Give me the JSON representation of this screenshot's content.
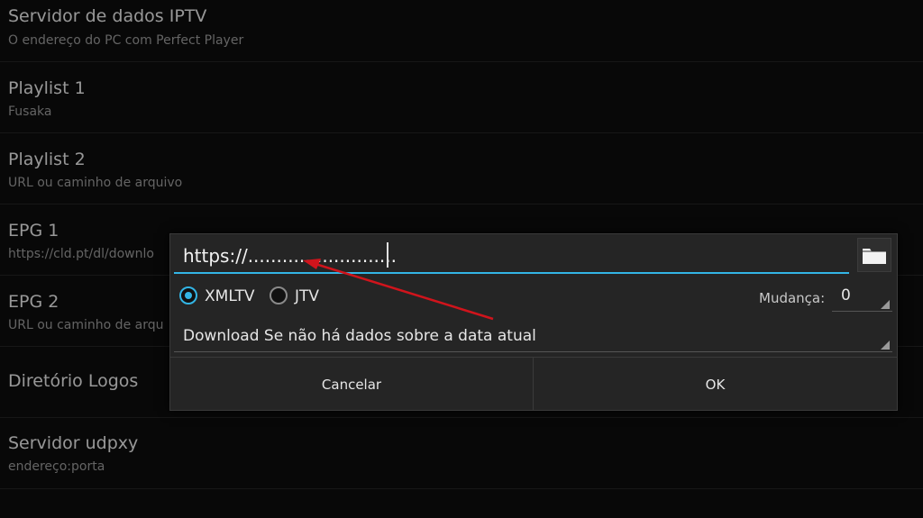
{
  "preferences": [
    {
      "title": "Servidor de dados IPTV",
      "summary": "O endereço do PC com Perfect Player"
    },
    {
      "title": "Playlist 1",
      "summary": "Fusaka"
    },
    {
      "title": "Playlist 2",
      "summary": "URL ou caminho de arquivo"
    },
    {
      "title": "EPG 1",
      "summary": "https://cld.pt/dl/downlo"
    },
    {
      "title": "EPG 2",
      "summary": "URL ou caminho de arqu"
    },
    {
      "title": "Diretório Logos",
      "summary": ""
    },
    {
      "title": "Servidor udpxy",
      "summary": "endereço:porta"
    }
  ],
  "dialog": {
    "url_value": "https://..........................",
    "folder_icon": "folder-icon",
    "format_options": [
      "XMLTV",
      "JTV"
    ],
    "format_selected": "XMLTV",
    "shift_label": "Mudança:",
    "shift_value": "0",
    "download_mode": "Download Se não há dados sobre a data atual",
    "cancel_label": "Cancelar",
    "ok_label": "OK"
  },
  "colors": {
    "accent": "#33b5e5",
    "annotation_arrow": "#d0141c"
  }
}
